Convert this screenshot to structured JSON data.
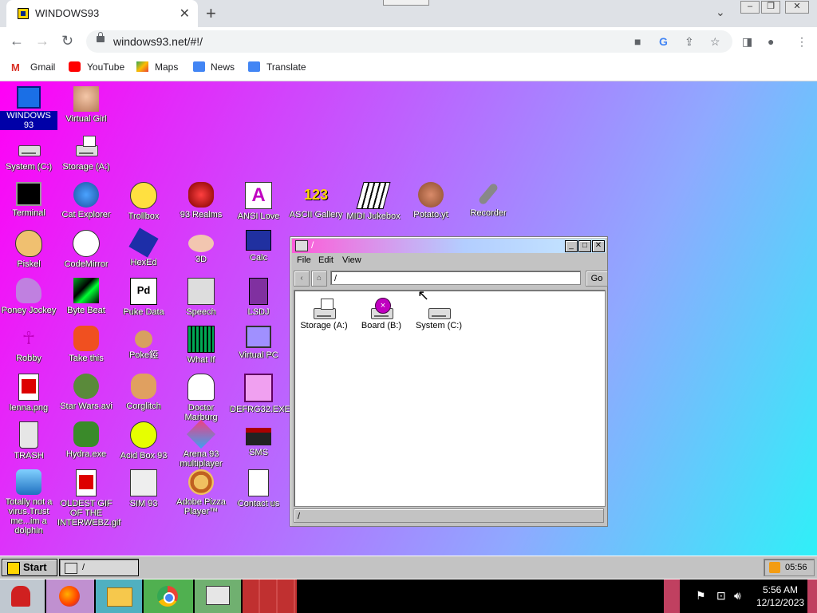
{
  "browser": {
    "tab_title": "WINDOWS93",
    "tab_close": "✕",
    "new_tab": "+",
    "url": "windows93.net/#!/",
    "bookmarks": [
      "Gmail",
      "YouTube",
      "Maps",
      "News",
      "Translate"
    ]
  },
  "desktop": {
    "icons": [
      {
        "label": "WINDOWS 93",
        "selected": true
      },
      {
        "label": "Virtual Girl"
      },
      {
        "label": "System (C:)"
      },
      {
        "label": "Storage (A:)"
      },
      {
        "label": "Terminal"
      },
      {
        "label": "Cat Explorer"
      },
      {
        "label": "Trollbox"
      },
      {
        "label": "93 Realms"
      },
      {
        "label": "ANSI Love"
      },
      {
        "label": "ASCII Gallery"
      },
      {
        "label": "MIDI Jukebox"
      },
      {
        "label": "Potato.yt"
      },
      {
        "label": "Recorder"
      },
      {
        "label": "Piskel"
      },
      {
        "label": "CodeMirror"
      },
      {
        "label": "HexEd"
      },
      {
        "label": "3D"
      },
      {
        "label": "Calc"
      },
      {
        "label": "Poney Jockey"
      },
      {
        "label": "Byte Beat"
      },
      {
        "label": "Puke Data"
      },
      {
        "label": "Speech"
      },
      {
        "label": "LSDJ"
      },
      {
        "label": "Robby"
      },
      {
        "label": "Take this"
      },
      {
        "label": "Poke錏"
      },
      {
        "label": "What If"
      },
      {
        "label": "Virtual PC"
      },
      {
        "label": "lenna.png"
      },
      {
        "label": "Star Wars.avi"
      },
      {
        "label": "Corglitch"
      },
      {
        "label": "Doctor Marburg"
      },
      {
        "label": "DEFRG32.EXE"
      },
      {
        "label": "TRASH"
      },
      {
        "label": "Hydra.exe"
      },
      {
        "label": "Acid Box 93"
      },
      {
        "label": "Arena 93 multiplayer"
      },
      {
        "label": "SMS"
      },
      {
        "label": "Totally not a virus.Trust me...im a dolphin"
      },
      {
        "label": "OLDEST GIF OF THE INTERWEBZ.gif"
      },
      {
        "label": "SIM 93"
      },
      {
        "label": "Adobe Pizza Player™"
      },
      {
        "label": "Contact us"
      }
    ]
  },
  "window": {
    "title": "/",
    "menu": [
      "File",
      "Edit",
      "View"
    ],
    "path": "/",
    "go": "Go",
    "items": [
      "Storage (A:)",
      "Board (B:)",
      "System (C:)"
    ],
    "status": "/"
  },
  "w93taskbar": {
    "start": "Start",
    "task": "/",
    "clock": "05:56"
  },
  "os": {
    "time": "5:56 AM",
    "date": "12/12/2023"
  }
}
